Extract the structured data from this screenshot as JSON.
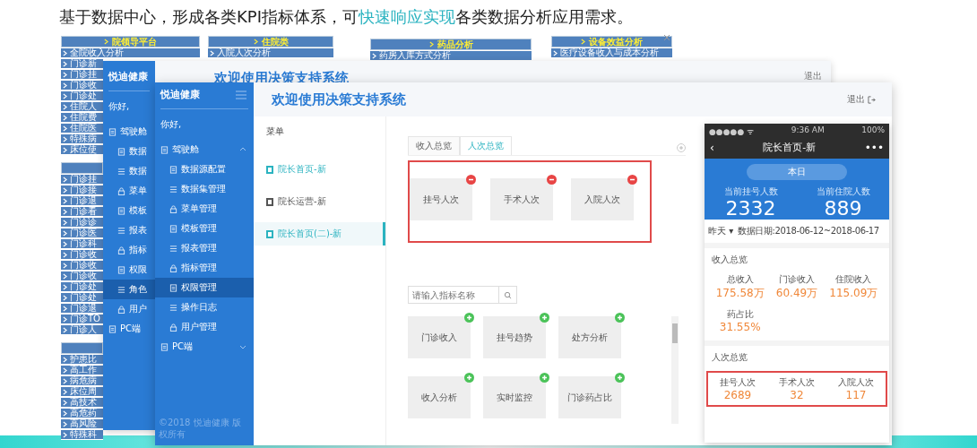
{
  "headline": {
    "before": "基于数据中心，形成各类KPI指标体系，可",
    "highlight": "快速响应实现",
    "after": "各类数据分析应用需求。"
  },
  "legacy_menus": [
    {
      "title": "院领导平台",
      "items": [
        "全院收入分析"
      ],
      "groups": [
        [
          "门诊新",
          "门诊挂",
          "门诊收",
          "门诊处",
          "住院人",
          "住院费",
          "住院医",
          "特殊病",
          "床位使"
        ],
        [
          "门诊挂",
          "门诊接",
          "门诊退",
          "门诊看",
          "门诊诊",
          "门诊医",
          "门诊科",
          "门诊收",
          "门诊收",
          "门诊收",
          "门诊处",
          "门诊处",
          "门诊退",
          "门诊TO",
          "门诊人"
        ],
        [
          "护患比",
          "高工作",
          "病危病",
          "床位周",
          "高技术",
          "高危药",
          "高风险",
          "特殊科"
        ]
      ]
    },
    {
      "title": "住院类",
      "items": [
        "入院人次分析"
      ]
    },
    {
      "title": "药品分析",
      "items": [
        "药房入库方式分析"
      ]
    },
    {
      "title": "设备效益分析",
      "items": [
        "医疗设备收入与成本分析"
      ]
    }
  ],
  "back_window": {
    "logo": "悦迪健康",
    "title": "欢迎使用决策支持系统",
    "logout": "退出",
    "greeting": "你好,",
    "nav": [
      {
        "label": "驾驶舱",
        "selected": false,
        "children": [
          {
            "label": "数据",
            "selected": false
          },
          {
            "label": "数据",
            "selected": false
          },
          {
            "label": "菜单",
            "selected": false
          },
          {
            "label": "模板",
            "selected": false
          },
          {
            "label": "报表",
            "selected": false
          },
          {
            "label": "指标",
            "selected": false
          },
          {
            "label": "权限",
            "selected": false
          },
          {
            "label": "角色",
            "selected": true
          },
          {
            "label": "用户",
            "selected": false
          }
        ]
      },
      {
        "label": "PC端",
        "selected": false
      }
    ]
  },
  "window": {
    "logo": "悦迪健康",
    "title": "欢迎使用决策支持系统",
    "logout": "退出",
    "greeting": "你好,",
    "footer": "©2018 悦迪健康 版权所有",
    "nav": [
      {
        "label": "驾驶舱",
        "selected": false,
        "expanded": true,
        "children": [
          {
            "label": "数据源配置",
            "selected": false
          },
          {
            "label": "数据集管理",
            "selected": false
          },
          {
            "label": "菜单管理",
            "selected": false
          },
          {
            "label": "模板管理",
            "selected": false
          },
          {
            "label": "报表管理",
            "selected": false
          },
          {
            "label": "指标管理",
            "selected": false
          },
          {
            "label": "权限管理",
            "selected": true
          },
          {
            "label": "操作日志",
            "selected": false
          },
          {
            "label": "用户管理",
            "selected": false
          }
        ]
      },
      {
        "label": "PC端",
        "selected": false,
        "expanded": false
      }
    ],
    "menu": {
      "title": "菜单",
      "items": [
        {
          "label": "院长首页-新",
          "selected": false,
          "color": "#2bb3c0"
        },
        {
          "label": "院长运营-新",
          "selected": false,
          "color": "#555555"
        },
        {
          "label": "院长首页(二)-新",
          "selected": true,
          "color": "#2bb3c0"
        }
      ]
    },
    "tabs": [
      {
        "label": "收入总览",
        "selected": false
      },
      {
        "label": "人次总览",
        "selected": true
      }
    ],
    "pinned": [
      "挂号人次",
      "手术人次",
      "入院人次"
    ],
    "search": {
      "placeholder": "请输入指标名称"
    },
    "available": [
      "门诊收入",
      "挂号趋势",
      "处方分析",
      "收入分析",
      "实时监控",
      "门诊药占比"
    ]
  },
  "phone": {
    "carrier": "●●●●● ᯤ",
    "time": "9:36 AM",
    "battery": "100%",
    "back": "‹",
    "title": "院长首页-新",
    "more": "•••",
    "range_button": "本日",
    "headline_stats": [
      {
        "label": "当前挂号人数",
        "value": "2332"
      },
      {
        "label": "当前住院人数",
        "value": "889"
      }
    ],
    "period": "昨天 ▾",
    "date_range": "数据日期:2018-06-12~2018-06-17",
    "sections": [
      {
        "title": "收入总览",
        "highlighted": false,
        "stats": [
          {
            "label": "总收入",
            "value": "175.58万"
          },
          {
            "label": "门诊收入",
            "value": "60.49万"
          },
          {
            "label": "住院收入",
            "value": "115.09万"
          },
          {
            "label": "药占比",
            "value": "31.55%"
          }
        ]
      },
      {
        "title": "人次总览",
        "highlighted": true,
        "stats": [
          {
            "label": "挂号人次",
            "value": "2689"
          },
          {
            "label": "手术人次",
            "value": "32"
          },
          {
            "label": "入院人次",
            "value": "117"
          }
        ]
      }
    ]
  }
}
